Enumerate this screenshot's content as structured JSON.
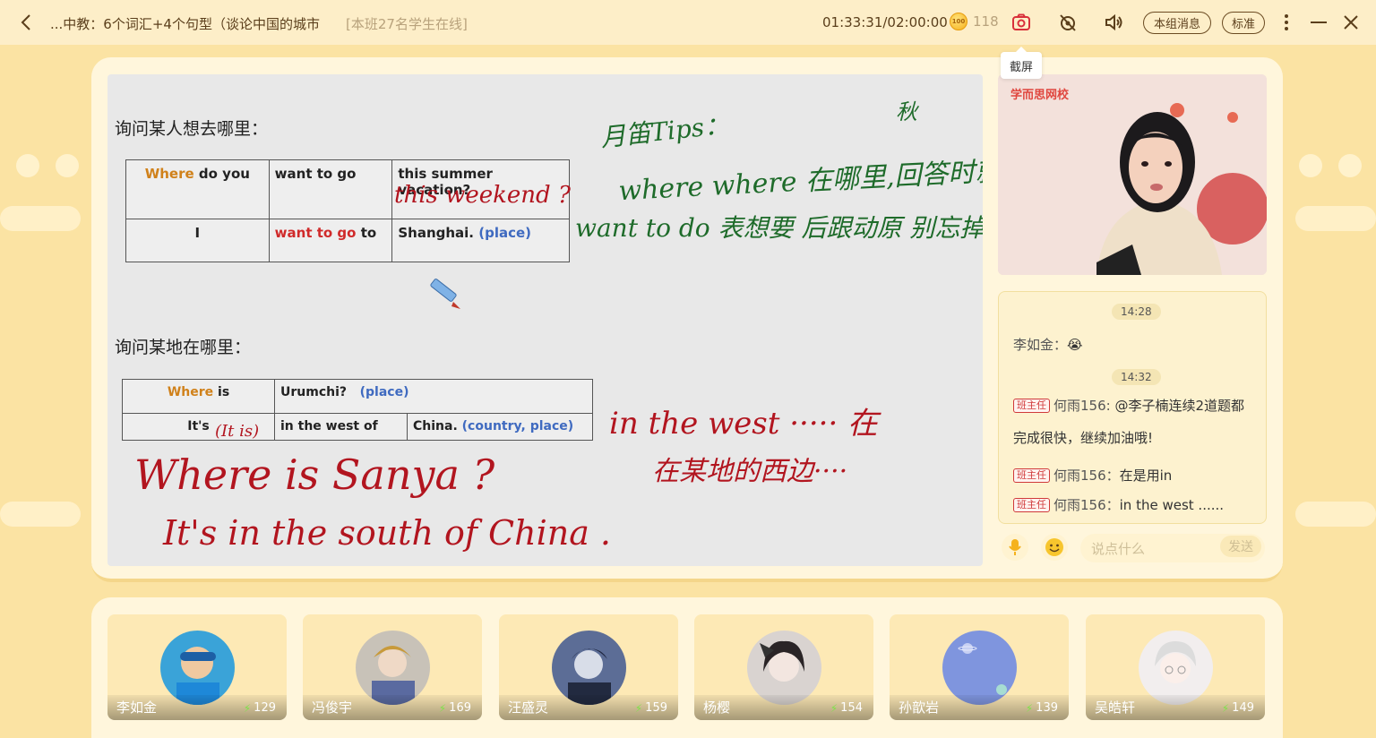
{
  "topbar": {
    "title": "...中教：6个词汇+4个句型（谈论中国的城市",
    "online": "[本班27名学生在线]",
    "timer": "01:33:31/02:00:00",
    "coins": "118",
    "coin_icon_text": "100",
    "group_msg_label": "本组消息",
    "quality_label": "标准",
    "screenshot_tooltip": "截屏",
    "icons": [
      "back-icon",
      "camera-icon",
      "camera-off-icon",
      "speaker-icon",
      "more-icon",
      "minimize-icon",
      "close-icon"
    ]
  },
  "board": {
    "heading1": "询问某人想去哪里：",
    "table1": {
      "r1c1_a": "Where",
      "r1c1_b": "do you",
      "r1c2": "want to go",
      "r1c3": "this summer vacation?",
      "r2c1": "I",
      "r2c2_a": "want to go",
      "r2c2_b": "to",
      "r2c3_a": "Shanghai.",
      "r2c3_b": "(place)"
    },
    "heading2": "询问某地在哪里：",
    "table2": {
      "r1c1_a": "Where",
      "r1c1_b": "is",
      "r1c2_a": "Urumchi?",
      "r1c2_b": "(place)",
      "r2c1": "It's",
      "r2c2": "in the west of",
      "r2c3_a": "China.",
      "r2c3_b": "(country, place)"
    },
    "handwriting": {
      "weekend": "this weekend ?",
      "tips": "月笛Tips：",
      "autumn": "秋",
      "green1": "where where 在哪里,回答时就",
      "green2": "want to do 表想要 后跟动原 别忘掉",
      "it_is": "(It is)",
      "west": "in the west ····· 在",
      "west_cn": "在某地的西边····",
      "q": "Where is Sanya ?",
      "a": "It's in the south of China ."
    }
  },
  "video": {
    "logo": "学而思网校"
  },
  "chat": {
    "time1": "14:28",
    "msg1_name": "李如金：",
    "msg1_emoji": "😭",
    "time2": "14:32",
    "tag": "班主任",
    "msg2_name": "何雨156:",
    "msg2_text_a": "@李子楠连续2道题都",
    "msg2_text_b": "完成很快，继续加油哦!",
    "msg3_name": "何雨156：",
    "msg3_text": "在是用in",
    "msg4_name": "何雨156：",
    "msg4_text": "in the west ......",
    "input_placeholder": "说点什么",
    "send_label": "发送"
  },
  "students": [
    {
      "name": "李如金",
      "score": "129"
    },
    {
      "name": "冯俊宇",
      "score": "169"
    },
    {
      "name": "汪盛灵",
      "score": "159"
    },
    {
      "name": "杨樱",
      "score": "154"
    },
    {
      "name": "孙歆岩",
      "score": "139"
    },
    {
      "name": "吴皓轩",
      "score": "149"
    }
  ],
  "colors": {
    "background": "#fbe3a3",
    "panel": "#fff6dc",
    "board": "#e8e8e8",
    "ink_red": "#b2151f",
    "ink_green": "#1e6b2a"
  }
}
